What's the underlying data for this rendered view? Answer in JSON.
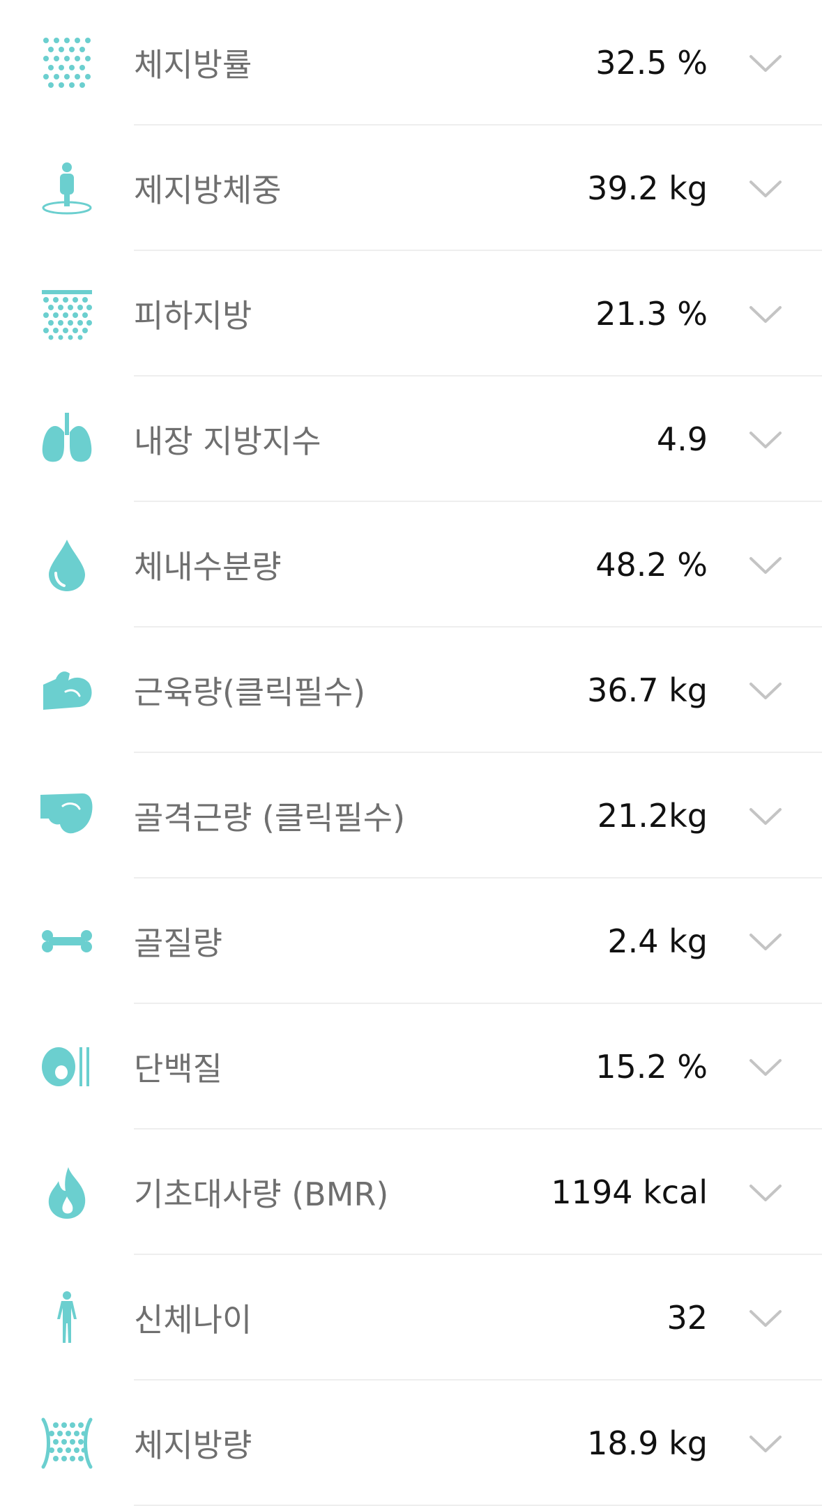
{
  "accent_color": "#6bcfcf",
  "metrics": [
    {
      "label": "체지방률",
      "value": "32.5 %",
      "icon": "dots-grid-icon"
    },
    {
      "label": "제지방체중",
      "value": "39.2 kg",
      "icon": "person-pin-icon"
    },
    {
      "label": "피하지방",
      "value": "21.3 %",
      "icon": "subcutaneous-fat-icon"
    },
    {
      "label": "내장 지방지수",
      "value": "4.9",
      "icon": "lungs-icon"
    },
    {
      "label": "체내수분량",
      "value": "48.2 %",
      "icon": "water-drop-icon"
    },
    {
      "label": "근육량(클릭필수)",
      "value": "36.7 kg",
      "icon": "muscle-arm-icon"
    },
    {
      "label": "골격근량 (클릭필수)",
      "value": "21.2kg",
      "icon": "skeletal-muscle-icon"
    },
    {
      "label": "골질량",
      "value": "2.4 kg",
      "icon": "bone-icon"
    },
    {
      "label": "단백질",
      "value": "15.2 %",
      "icon": "egg-icon"
    },
    {
      "label": "기초대사량 (BMR)",
      "value": "1194 kcal",
      "icon": "flame-icon"
    },
    {
      "label": "신체나이",
      "value": "32",
      "icon": "body-figure-icon"
    },
    {
      "label": "체지방량",
      "value": "18.9 kg",
      "icon": "fat-mass-icon"
    }
  ]
}
